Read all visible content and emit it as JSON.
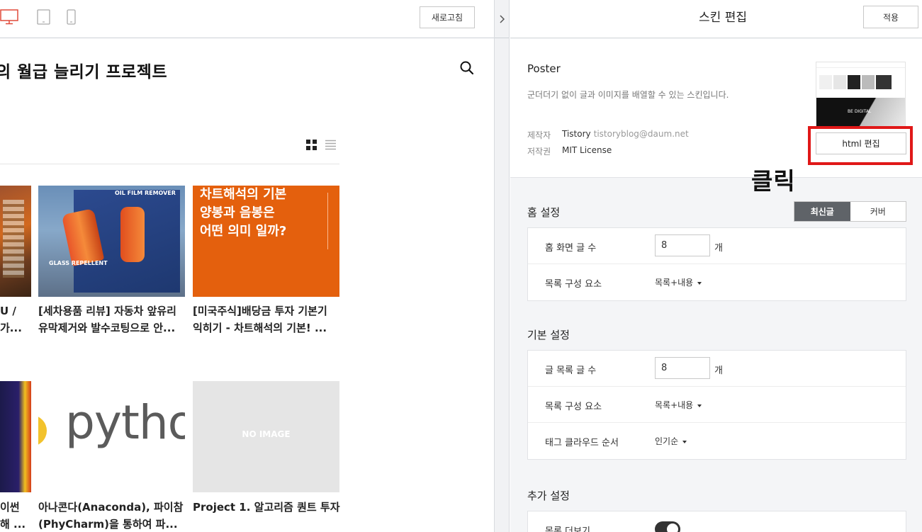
{
  "preview": {
    "refresh_label": "새로고침",
    "blog_title": "의 월급 늘리기 프로젝트",
    "posts_row1": [
      {
        "title_line1": "U /",
        "title_line2": " 가..."
      },
      {
        "title_line1": "[세차용품 리뷰] 자동차 앞유리",
        "title_line2": "유막제거와 발수코팅으로 안...",
        "img_label_top": "OIL FILM REMOVER",
        "img_label_bottom": "GLASS REPELLENT"
      },
      {
        "title_line1": "[미국주식]배당금 투자 기본기",
        "title_line2": "익히기 - 차트해석의 기본! ...",
        "img_text_line1": "차트해석의 기본",
        "img_text_line2": "양봉과 음봉은",
        "img_text_line3": "어떤 의미 일까?"
      }
    ],
    "posts_row2": [
      {
        "title_line1": "이썬",
        "title_line2": "해 ..."
      },
      {
        "title_line1": "아나콘다(Anaconda), 파이참",
        "title_line2": "(PhyCharm)을 통하여 파...",
        "img_text": "pytho"
      },
      {
        "title_line1": "Project 1. 알고리즘 퀀트 투자",
        "title_line2": "",
        "img_text": "NO IMAGE"
      }
    ]
  },
  "editor": {
    "title": "스킨 편집",
    "apply_label": "적용",
    "skin": {
      "name": "Poster",
      "description": "군더더기 없이 글과 이미지를 배열할 수 있는 스킨입니다.",
      "author_label": "제작자",
      "author": "Tistory",
      "author_email": "tistoryblog@daum.net",
      "license_label": "저작권",
      "license": "MIT License",
      "thumb_text": "BE DIGITAL",
      "html_edit_label": "html 편집"
    },
    "annotation": "클릭",
    "home_settings": {
      "title": "홈 설정",
      "seg_active": "최신글",
      "seg_inactive": "커버",
      "rows": [
        {
          "label": "홈 화면 글 수",
          "value": "8",
          "unit": "개"
        },
        {
          "label": "목록 구성 요소",
          "value": "목록+내용"
        }
      ]
    },
    "basic_settings": {
      "title": "기본 설정",
      "rows": [
        {
          "label": "글 목록 글 수",
          "value": "8",
          "unit": "개"
        },
        {
          "label": "목록 구성 요소",
          "value": "목록+내용"
        },
        {
          "label": "태그 클라우드 순서",
          "value": "인기순"
        }
      ]
    },
    "extra_settings": {
      "title": "추가 설정",
      "rows": [
        {
          "label": "목록 더보기",
          "toggle_on": true
        }
      ]
    }
  },
  "colors": {
    "highlight_outline": "#e01818",
    "segment_active_bg": "#5f6368",
    "orange_thumb": "#e4600d"
  }
}
